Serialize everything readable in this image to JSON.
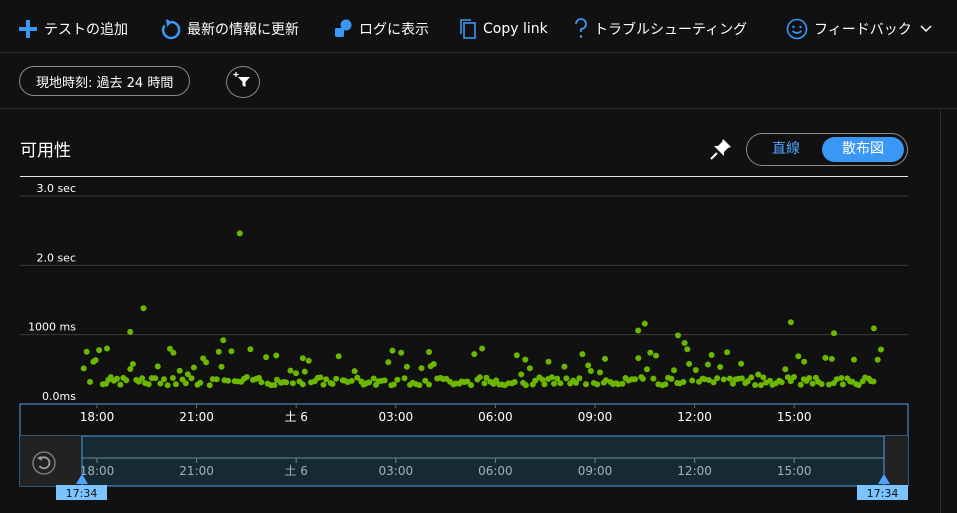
{
  "toolbar": {
    "items": [
      {
        "label": "テストの追加",
        "icon": "plus-icon"
      },
      {
        "label": "最新の情報に更新",
        "icon": "refresh-icon"
      },
      {
        "label": "ログに表示",
        "icon": "logs-icon"
      },
      {
        "label": "Copy link",
        "icon": "copy-icon"
      },
      {
        "label": "トラブルシューティング",
        "icon": "question-icon"
      },
      {
        "label": "フィードバック",
        "icon": "smiley-icon"
      }
    ]
  },
  "filter": {
    "time_range": "現地時刻: 過去 24 時間",
    "icon": "add-filter-icon"
  },
  "panel": {
    "title": "可用性",
    "pin_icon": "pin-icon",
    "toggle": {
      "line": "直線",
      "scatter": "散布図",
      "selected": "散布図"
    }
  },
  "colors": {
    "point": "#6bb700",
    "accent": "#3a97f4",
    "background": "#111111"
  },
  "chart_data": {
    "type": "scatter",
    "ylabel": "",
    "y_tick_labels": [
      "0.0ms",
      "1000 ms",
      "2.0 sec",
      "3.0 sec"
    ],
    "y_ticks": [
      0,
      1000,
      2000,
      3000
    ],
    "ylim": [
      0,
      3000
    ],
    "x_tick_labels": [
      "18:00",
      "21:00",
      "土 6",
      "03:00",
      "06:00",
      "09:00",
      "12:00",
      "15:00"
    ],
    "x_ticks": [
      18,
      21,
      24,
      27,
      30,
      33,
      36,
      39
    ],
    "xlim": [
      16.2,
      42.6
    ],
    "range_start_label": "17:34",
    "range_end_label": "17:34",
    "reset_icon": "reset-zoom-icon",
    "points_x": [],
    "points_y": []
  }
}
